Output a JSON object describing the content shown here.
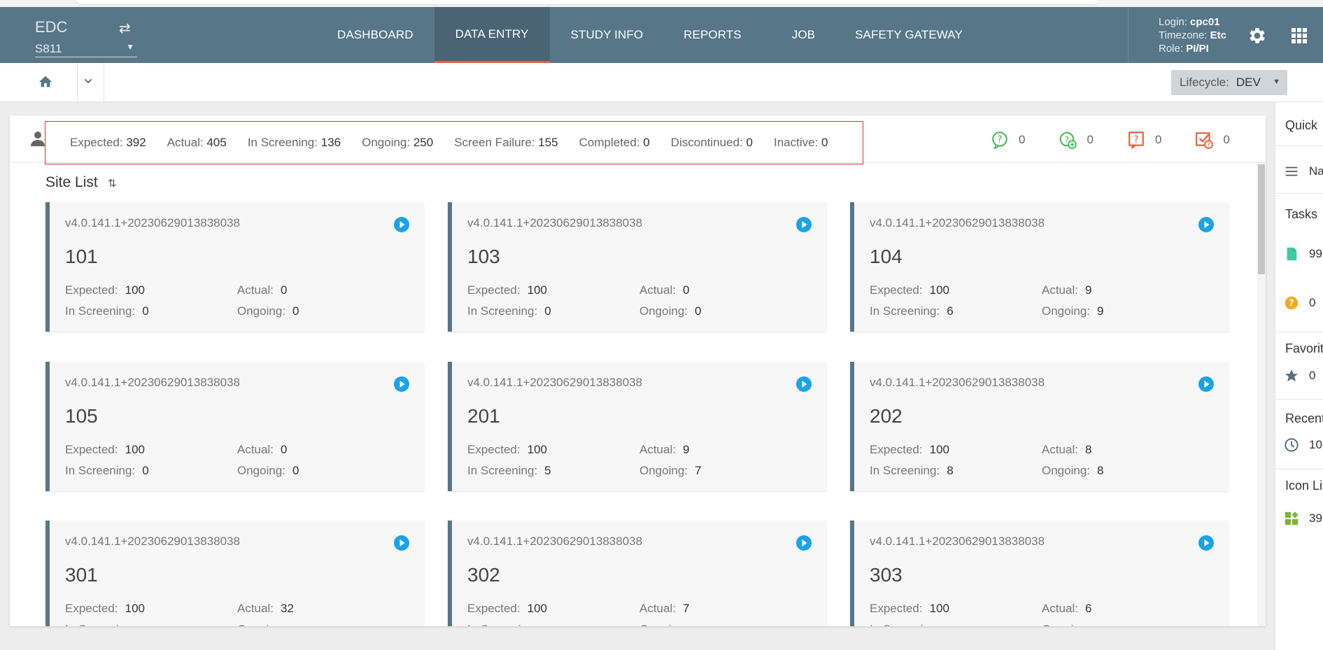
{
  "app": {
    "brand": "EDC",
    "study": "S811"
  },
  "nav": {
    "items": [
      "DASHBOARD",
      "DATA ENTRY",
      "STUDY INFO",
      "REPORTS",
      "JOB",
      "SAFETY GATEWAY"
    ],
    "active": "DATA ENTRY"
  },
  "user": {
    "login_label": "Login:",
    "login": "cpc01",
    "timezone_label": "Timezone:",
    "timezone": "Etc",
    "role_label": "Role:",
    "role": "PI/PI"
  },
  "lifecycle": {
    "label": "Lifecycle:",
    "value": "DEV"
  },
  "stats": [
    {
      "label": "Expected:",
      "value": "392"
    },
    {
      "label": "Actual:",
      "value": "405"
    },
    {
      "label": "In Screening:",
      "value": "136"
    },
    {
      "label": "Ongoing:",
      "value": "250"
    },
    {
      "label": "Screen Failure:",
      "value": "155"
    },
    {
      "label": "Completed:",
      "value": "0"
    },
    {
      "label": "Discontinued:",
      "value": "0"
    },
    {
      "label": "Inactive:",
      "value": "0"
    }
  ],
  "status_counts": [
    {
      "icon": "open-query-icon",
      "color": "#3bb34a",
      "value": "0"
    },
    {
      "icon": "answered-query-icon",
      "color": "#3bb34a",
      "value": "0"
    },
    {
      "icon": "new-query-icon",
      "color": "#e8502c",
      "value": "0"
    },
    {
      "icon": "verify-query-icon",
      "color": "#e8502c",
      "value": "0"
    }
  ],
  "site_list": {
    "title": "Site List",
    "labels": {
      "expected": "Expected:",
      "actual": "Actual:",
      "in_screening": "In Screening:",
      "ongoing": "Ongoing:"
    },
    "sites": [
      {
        "version": "v4.0.141.1+20230629013838038",
        "site": "101",
        "expected": "100",
        "actual": "0",
        "in_screening": "0",
        "ongoing": "0"
      },
      {
        "version": "v4.0.141.1+20230629013838038",
        "site": "103",
        "expected": "100",
        "actual": "0",
        "in_screening": "0",
        "ongoing": "0"
      },
      {
        "version": "v4.0.141.1+20230629013838038",
        "site": "104",
        "expected": "100",
        "actual": "9",
        "in_screening": "6",
        "ongoing": "9"
      },
      {
        "version": "v4.0.141.1+20230629013838038",
        "site": "105",
        "expected": "100",
        "actual": "0",
        "in_screening": "0",
        "ongoing": "0"
      },
      {
        "version": "v4.0.141.1+20230629013838038",
        "site": "201",
        "expected": "100",
        "actual": "9",
        "in_screening": "5",
        "ongoing": "7"
      },
      {
        "version": "v4.0.141.1+20230629013838038",
        "site": "202",
        "expected": "100",
        "actual": "8",
        "in_screening": "8",
        "ongoing": "8"
      },
      {
        "version": "v4.0.141.1+20230629013838038",
        "site": "301",
        "expected": "100",
        "actual": "32",
        "in_screening": "",
        "ongoing": ""
      },
      {
        "version": "v4.0.141.1+20230629013838038",
        "site": "302",
        "expected": "100",
        "actual": "7",
        "in_screening": "",
        "ongoing": ""
      },
      {
        "version": "v4.0.141.1+20230629013838038",
        "site": "303",
        "expected": "100",
        "actual": "6",
        "in_screening": "",
        "ongoing": ""
      }
    ]
  },
  "right_panel": {
    "quick": "Quick",
    "nav_label": "Na",
    "tasks": "Tasks",
    "task_docs": "99",
    "task_queries": "0",
    "favorites": "Favorite",
    "favorites_count": "0",
    "recent": "Recent",
    "recent_count": "10",
    "icon_list": "Icon Lis",
    "icon_list_count": "39"
  },
  "colors": {
    "header": "#577688",
    "active_tab_underline": "#e95b45",
    "highlight_box": "#e02d2d",
    "play_button": "#1aa3e8"
  }
}
